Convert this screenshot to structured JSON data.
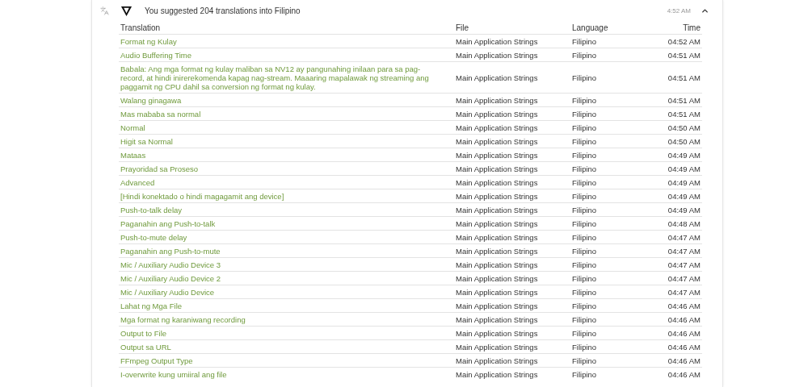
{
  "activity": {
    "title": "You suggested 204 translations into Filipino",
    "time": "4:52 AM",
    "expanded": true
  },
  "table": {
    "columns": [
      "Translation",
      "File",
      "Language",
      "Time"
    ],
    "rows": [
      {
        "translation": "Format ng Kulay",
        "file": "Main Application Strings",
        "language": "Filipino",
        "time": "04:52 AM"
      },
      {
        "translation": "Audio Buffering Time",
        "file": "Main Application Strings",
        "language": "Filipino",
        "time": "04:51 AM"
      },
      {
        "translation": "Babala: Ang mga format ng kulay maliban sa NV12 ay pangunahing inilaan para sa pag-record, at hindi inirerekomenda kapag nag-stream. Maaaring mapalawak ng streaming ang paggamit ng CPU dahil sa conversion ng format ng kulay.",
        "file": "Main Application Strings",
        "language": "Filipino",
        "time": "04:51 AM"
      },
      {
        "translation": "Walang ginagawa",
        "file": "Main Application Strings",
        "language": "Filipino",
        "time": "04:51 AM"
      },
      {
        "translation": "Mas mababa sa normal",
        "file": "Main Application Strings",
        "language": "Filipino",
        "time": "04:51 AM"
      },
      {
        "translation": "Normal",
        "file": "Main Application Strings",
        "language": "Filipino",
        "time": "04:50 AM"
      },
      {
        "translation": "Higit sa Normal",
        "file": "Main Application Strings",
        "language": "Filipino",
        "time": "04:50 AM"
      },
      {
        "translation": "Mataas",
        "file": "Main Application Strings",
        "language": "Filipino",
        "time": "04:49 AM"
      },
      {
        "translation": "Prayoridad sa Proseso",
        "file": "Main Application Strings",
        "language": "Filipino",
        "time": "04:49 AM"
      },
      {
        "translation": "Advanced",
        "file": "Main Application Strings",
        "language": "Filipino",
        "time": "04:49 AM"
      },
      {
        "translation": "[Hindi konektado o hindi magagamit ang device]",
        "file": "Main Application Strings",
        "language": "Filipino",
        "time": "04:49 AM"
      },
      {
        "translation": "Push-to-talk delay",
        "file": "Main Application Strings",
        "language": "Filipino",
        "time": "04:49 AM"
      },
      {
        "translation": "Paganahin ang Push-to-talk",
        "file": "Main Application Strings",
        "language": "Filipino",
        "time": "04:48 AM"
      },
      {
        "translation": "Push-to-mute delay",
        "file": "Main Application Strings",
        "language": "Filipino",
        "time": "04:47 AM"
      },
      {
        "translation": "Paganahin ang Push-to-mute",
        "file": "Main Application Strings",
        "language": "Filipino",
        "time": "04:47 AM"
      },
      {
        "translation": "Mic / Auxiliary Audio Device 3",
        "file": "Main Application Strings",
        "language": "Filipino",
        "time": "04:47 AM"
      },
      {
        "translation": "Mic / Auxiliary Audio Device 2",
        "file": "Main Application Strings",
        "language": "Filipino",
        "time": "04:47 AM"
      },
      {
        "translation": "Mic / Auxiliary Audio Device",
        "file": "Main Application Strings",
        "language": "Filipino",
        "time": "04:47 AM"
      },
      {
        "translation": "Lahat ng Mga File",
        "file": "Main Application Strings",
        "language": "Filipino",
        "time": "04:46 AM"
      },
      {
        "translation": "Mga format ng karaniwang recording",
        "file": "Main Application Strings",
        "language": "Filipino",
        "time": "04:46 AM"
      },
      {
        "translation": "Output to File",
        "file": "Main Application Strings",
        "language": "Filipino",
        "time": "04:46 AM"
      },
      {
        "translation": "Output sa URL",
        "file": "Main Application Strings",
        "language": "Filipino",
        "time": "04:46 AM"
      },
      {
        "translation": "FFmpeg Output Type",
        "file": "Main Application Strings",
        "language": "Filipino",
        "time": "04:46 AM"
      },
      {
        "translation": "I-overwrite kung umiiral ang file",
        "file": "Main Application Strings",
        "language": "Filipino",
        "time": "04:46 AM"
      }
    ]
  }
}
